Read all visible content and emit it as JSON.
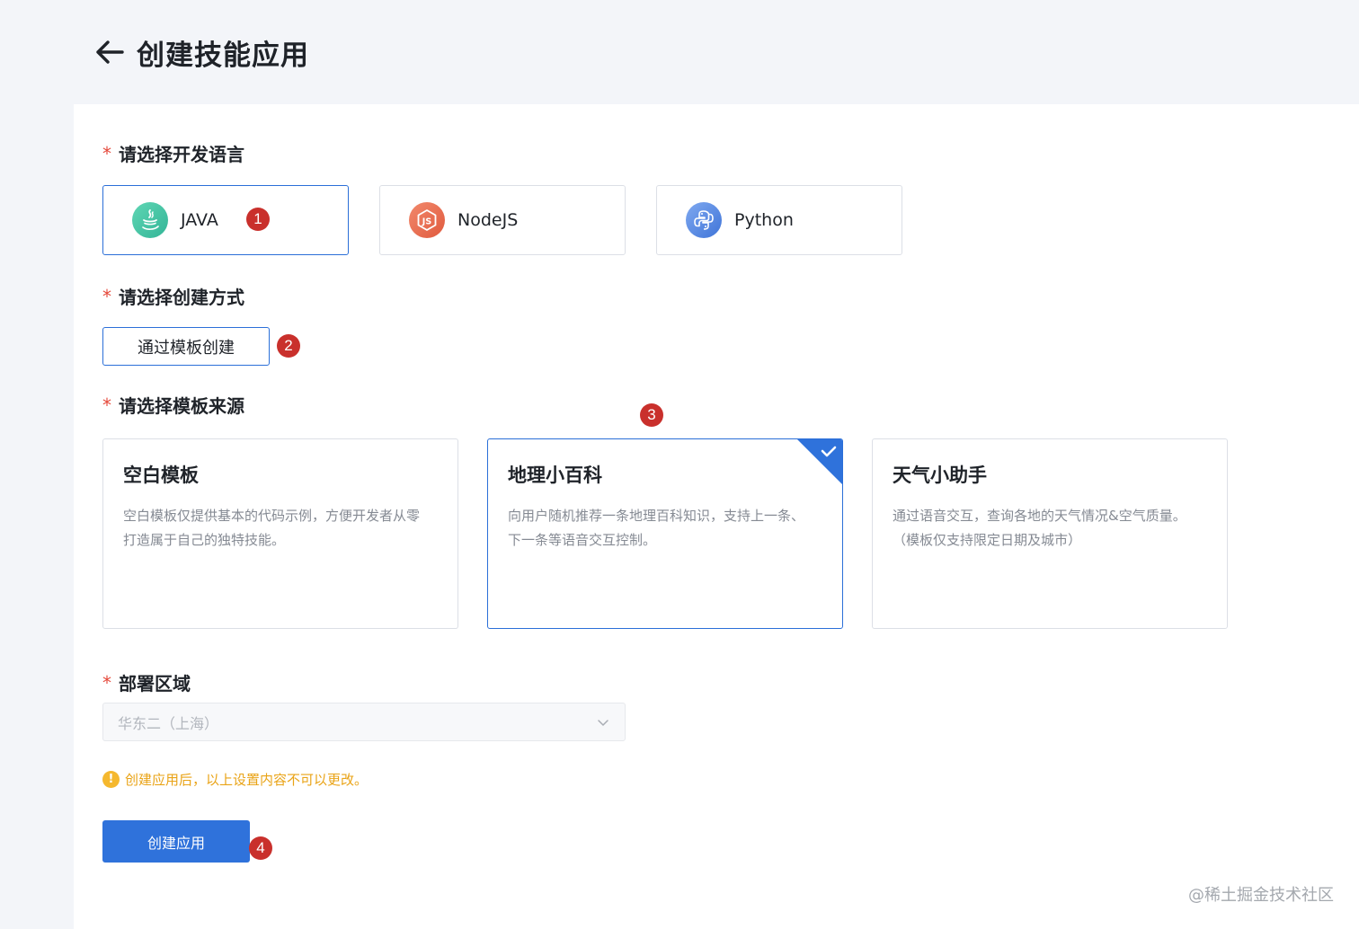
{
  "page": {
    "title": "创建技能应用"
  },
  "language_section": {
    "label": "请选择开发语言",
    "required_mark": "*",
    "options": [
      {
        "name": "JAVA",
        "icon": "java-icon",
        "selected": true
      },
      {
        "name": "NodeJS",
        "icon": "nodejs-icon",
        "selected": false
      },
      {
        "name": "Python",
        "icon": "python-icon",
        "selected": false
      }
    ]
  },
  "method_section": {
    "label": "请选择创建方式",
    "required_mark": "*",
    "button_label": "通过模板创建"
  },
  "template_section": {
    "label": "请选择模板来源",
    "required_mark": "*",
    "templates": [
      {
        "title": "空白模板",
        "desc_line1": "空白模板仅提供基本的代码示例，方便开发者从零",
        "desc_line2": "打造属于自己的独特技能。",
        "selected": false
      },
      {
        "title": "地理小百科",
        "desc_line1": "向用户随机推荐一条地理百科知识，支持上一条、",
        "desc_line2": "下一条等语音交互控制。",
        "selected": true
      },
      {
        "title": "天气小助手",
        "desc_line1": "通过语音交互，查询各地的天气情况&空气质量。",
        "desc_line2": "（模板仅支持限定日期及城市）",
        "selected": false
      }
    ]
  },
  "region_section": {
    "label": "部署区域",
    "required_mark": "*",
    "selected_value": "华东二（上海）"
  },
  "notice": {
    "icon": "!",
    "text": "创建应用后，以上设置内容不可以更改。"
  },
  "create_button": {
    "label": "创建应用"
  },
  "steps": [
    "1",
    "2",
    "3",
    "4"
  ],
  "watermark": "@稀土掘金技术社区",
  "colors": {
    "accent": "#2f72db",
    "badge": "#c9302c",
    "warning": "#f5b82e"
  }
}
